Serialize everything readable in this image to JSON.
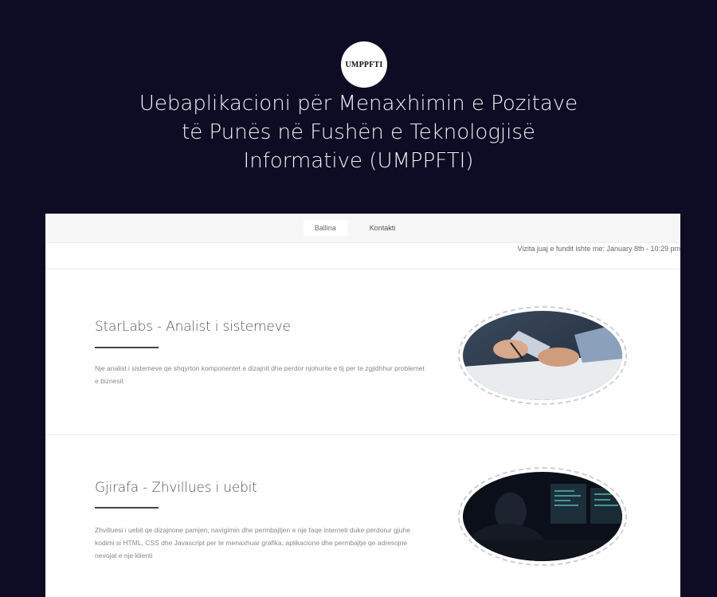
{
  "logo": {
    "text": "UMPPFTI"
  },
  "hero": {
    "title_lines": [
      "Uebaplikacioni për Menaxhimin e Pozitave",
      "të Punës në Fushën e Teknologjisë",
      "Informative (UMPPFTI)"
    ]
  },
  "nav": {
    "tabs": [
      {
        "label": "Ballina"
      },
      {
        "label": "Kontakti"
      }
    ]
  },
  "last_visit": "Vizita juaj e fundit ishte me: January 8th - 10:29 pm",
  "jobs": [
    {
      "title": "StarLabs - Analist i sistemeve",
      "description": "Nje analist i sistemeve qe shqyrton komponentet e dizajnit dhe perdor njohurite e tij per te zgjidhhur problemet e biznesit",
      "image_icon": "handshake-document-photo"
    },
    {
      "title": "Gjirafa - Zhvillues i uebit",
      "description": "Zhvilluesi i uebit qe dizajnone pamjen, navigimin dhe permbajtjen e nje faqe interneti duke perdorur gjuhe kodimi si HTML, CSS dhe Javascript per te menaxhuar grafika, aplikacione dhe permbajtje qe adresojne nevojat e nje klienti",
      "image_icon": "developer-monitors-photo"
    }
  ],
  "colors": {
    "page_bg": "#0d0c24",
    "card_bg": "#ffffff",
    "nav_bg": "#f6f6f6"
  }
}
